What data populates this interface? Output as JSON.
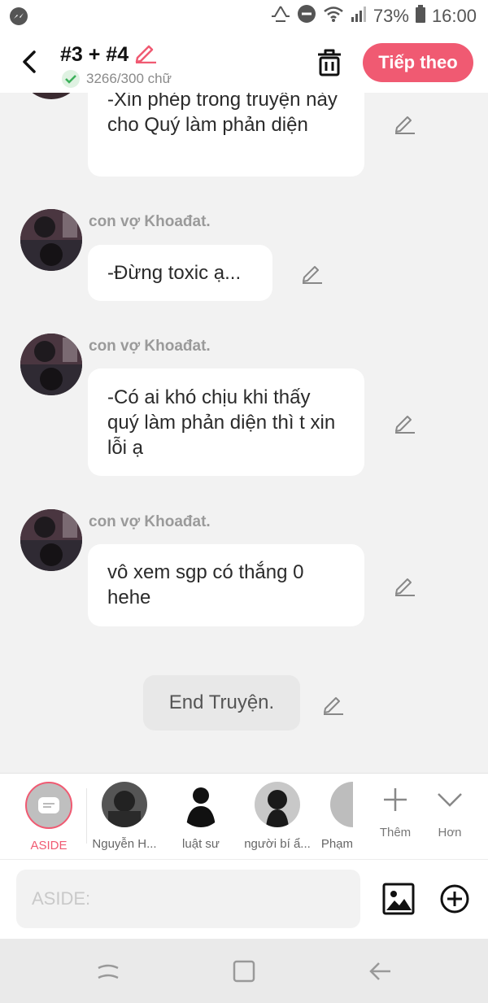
{
  "status_bar": {
    "battery": "73%",
    "time": "16:00",
    "icons": [
      "messenger-icon",
      "recycle-icon",
      "dnd-icon",
      "wifi-icon",
      "signal-icon",
      "battery-icon"
    ]
  },
  "header": {
    "title": "#3 + #4",
    "word_count": "3266/300 chữ",
    "next_label": "Tiếp theo",
    "accent": "#f05a72"
  },
  "messages": [
    {
      "sender": "",
      "text": "-Xin phép trong truyện này cho Quý làm phản diện"
    },
    {
      "sender": "con vợ Khoađat.",
      "text": "-Đừng toxic ạ..."
    },
    {
      "sender": "con vợ Khoađat.",
      "text": "-Có ai khó chịu khi thấy quý làm phản diện thì t xin lỗi ạ"
    },
    {
      "sender": "con vợ Khoađat.",
      "text": "vô xem sgp có thắng 0 hehe"
    }
  ],
  "end_text": "End Truyện.",
  "characters": [
    {
      "label": "ASIDE",
      "active": true
    },
    {
      "label": "Nguyễn H..."
    },
    {
      "label": "luật sư"
    },
    {
      "label": "người bí ẩ..."
    },
    {
      "label": "Phạm"
    }
  ],
  "tools": {
    "add_label": "Thêm",
    "more_label": "Hơn"
  },
  "input": {
    "placeholder": "ASIDE:"
  }
}
